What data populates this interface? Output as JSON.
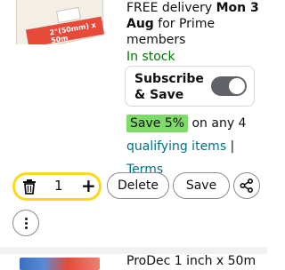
{
  "product": {
    "image_label": "2\"(50mm) x 50m",
    "delivery_prefix": "FREE delivery",
    "delivery_date": "Mon 3 Aug",
    "delivery_suffix": "for Prime members",
    "stock": "In stock",
    "subscribe_label": "Subscribe & Save",
    "subscribe_on": false,
    "save_badge": "Save 5%",
    "save_text": " on any 4",
    "qualifying_link": "qualifying items",
    "separator": " |",
    "terms_link": "Terms"
  },
  "actions": {
    "quantity": "1",
    "delete_label": "Delete",
    "save_label": "Save",
    "plus_symbol": "+",
    "share_icon": "share-icon",
    "trash_icon": "trash-icon",
    "more_icon": "more-vertical-icon"
  },
  "next_item": {
    "title": "ProDec 1 inch x 50m"
  },
  "colors": {
    "stock_green": "#007600",
    "badge_green": "#7fda69",
    "link_teal": "#007185",
    "qty_border": "#ffd814",
    "toggle_off": "#5f6368"
  }
}
